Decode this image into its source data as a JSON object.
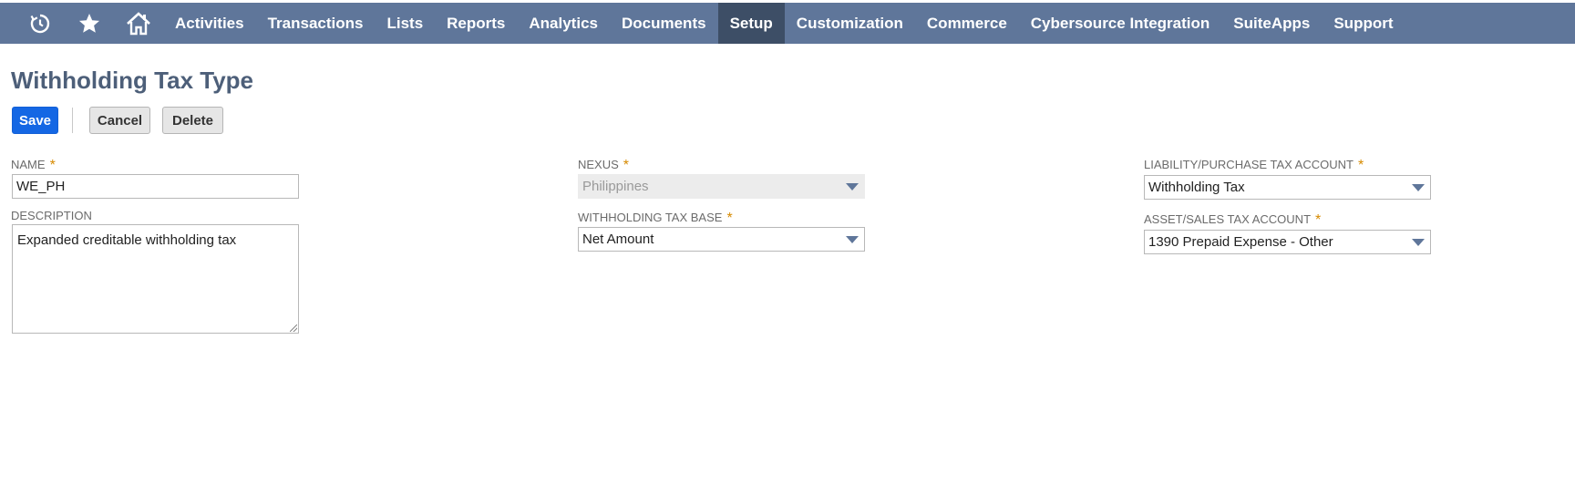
{
  "nav": {
    "icons": [
      {
        "name": "recent-records-icon"
      },
      {
        "name": "star-icon"
      },
      {
        "name": "home-icon"
      }
    ],
    "items": [
      {
        "label": "Activities",
        "active": false
      },
      {
        "label": "Transactions",
        "active": false
      },
      {
        "label": "Lists",
        "active": false
      },
      {
        "label": "Reports",
        "active": false
      },
      {
        "label": "Analytics",
        "active": false
      },
      {
        "label": "Documents",
        "active": false
      },
      {
        "label": "Setup",
        "active": true
      },
      {
        "label": "Customization",
        "active": false
      },
      {
        "label": "Commerce",
        "active": false
      },
      {
        "label": "Cybersource Integration",
        "active": false
      },
      {
        "label": "SuiteApps",
        "active": false
      },
      {
        "label": "Support",
        "active": false
      }
    ]
  },
  "page": {
    "title": "Withholding Tax Type"
  },
  "toolbar": {
    "save_label": "Save",
    "cancel_label": "Cancel",
    "delete_label": "Delete"
  },
  "form": {
    "name_label": "Name",
    "name_value": "WE_PH",
    "description_label": "Description",
    "description_value": "Expanded creditable withholding tax",
    "nexus_label": "Nexus",
    "nexus_value": "Philippines",
    "tax_base_label": "Withholding Tax Base",
    "tax_base_value": "Net Amount",
    "liability_label": "Liability/Purchase Tax Account",
    "liability_value": "Withholding Tax",
    "asset_label": "Asset/Sales Tax Account",
    "asset_value": "1390 Prepaid Expense - Other",
    "required_mark": "*"
  },
  "colors": {
    "nav_bg": "#5f769a",
    "nav_active": "#3d4e66",
    "save_button": "#1467e4",
    "required": "#d68a00"
  }
}
